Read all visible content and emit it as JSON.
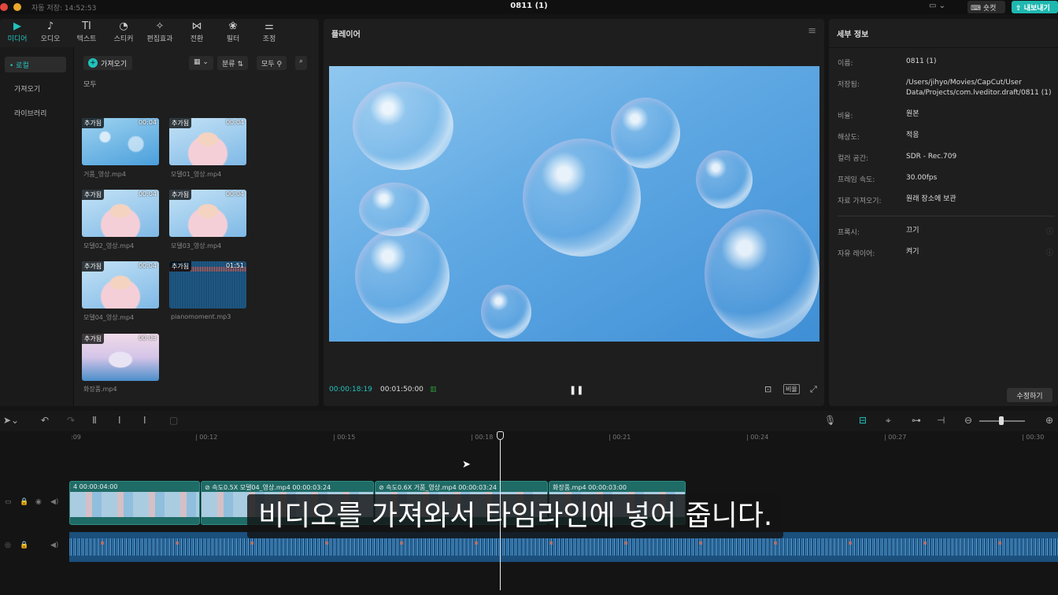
{
  "window": {
    "autosave": "자동 저장: 14:52:53",
    "title": "0811 (1)",
    "shortcut_label": "숏컷",
    "export_label": "내보내기"
  },
  "toolbar_tabs": [
    {
      "label": "미디어",
      "icon": "▶"
    },
    {
      "label": "오디오",
      "icon": "♪"
    },
    {
      "label": "텍스트",
      "icon": "TI"
    },
    {
      "label": "스티커",
      "icon": "◔"
    },
    {
      "label": "편집효과",
      "icon": "✧"
    },
    {
      "label": "전환",
      "icon": "⋈"
    },
    {
      "label": "필터",
      "icon": "❀"
    },
    {
      "label": "조정",
      "icon": "⚌"
    }
  ],
  "subnav": [
    "• 로컬",
    "가져오기",
    "라이브러리"
  ],
  "media": {
    "import_label": "가져오기",
    "sort_label": "분류",
    "filter_label": "모두",
    "section": "모두",
    "items": [
      {
        "tag": "추가됨",
        "duration": "00:04",
        "name": "거품_영상.mp4"
      },
      {
        "tag": "추가됨",
        "duration": "00:04",
        "name": "모델01_영상.mp4"
      },
      {
        "tag": "추가됨",
        "duration": "00:04",
        "name": "모델02_영상.mp4"
      },
      {
        "tag": "추가됨",
        "duration": "00:04",
        "name": "모델03_영상.mp4"
      },
      {
        "tag": "추가됨",
        "duration": "00:04",
        "name": "모델04_영상.mp4"
      },
      {
        "tag": "추가됨",
        "duration": "01:51",
        "name": "pianomoment.mp3"
      },
      {
        "tag": "추가됨",
        "duration": "00:03",
        "name": "화장품.mp4"
      }
    ]
  },
  "player": {
    "title": "플레이어",
    "current_time": "00:00:18:19",
    "total_time": "00:01:50:00",
    "ratio_label": "비율"
  },
  "details": {
    "title": "세부 정보",
    "rows": [
      {
        "key": "이름:",
        "value": "0811 (1)"
      },
      {
        "key": "저장됨:",
        "value": "/Users/jihyo/Movies/CapCut/User Data/Projects/com.lveditor.draft/0811 (1)"
      },
      {
        "key": "비율:",
        "value": "원본"
      },
      {
        "key": "해상도:",
        "value": "적응"
      },
      {
        "key": "컬러 공간:",
        "value": "SDR - Rec.709"
      },
      {
        "key": "프레임 속도:",
        "value": "30.00fps"
      },
      {
        "key": "자료 가져오기:",
        "value": "원래 장소에 보관"
      },
      {
        "key": "프록시:",
        "value": "끄기"
      },
      {
        "key": "자유 레이어:",
        "value": "켜기"
      }
    ],
    "edit_label": "수정하기"
  },
  "timeline": {
    "ruler": [
      ":09",
      "| 00:12",
      "| 00:15",
      "| 00:18",
      "| 00:21",
      "| 00:24",
      "| 00:27",
      "| 00:30"
    ],
    "clips": [
      {
        "label": "4  00:00:04:00"
      },
      {
        "label": "⊘ 속도0.5X  모델04_영상.mp4  00:00:03:24"
      },
      {
        "label": "⊘ 속도0.6X  거품_영상.mp4  00:00:03:24"
      },
      {
        "label": "화장품.mp4  00:00:03:00"
      }
    ]
  },
  "subtitle": "비디오를 가져와서 타임라인에 넣어 줍니다."
}
